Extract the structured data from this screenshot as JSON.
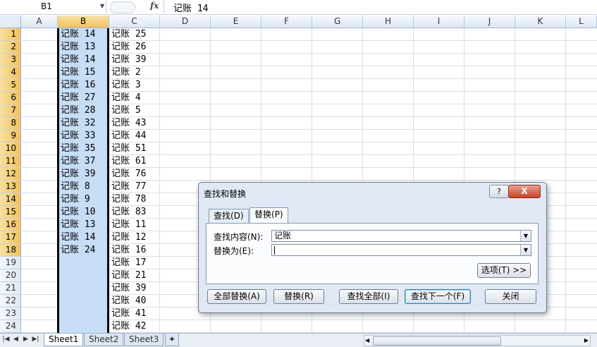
{
  "formula_bar": {
    "name_box": "B1",
    "fx_label": "fx",
    "content": "记账 14"
  },
  "columns": [
    "A",
    "B",
    "C",
    "D",
    "E",
    "F",
    "G",
    "H",
    "I",
    "J",
    "K",
    "L"
  ],
  "selected_column": "B",
  "rows": [
    "1",
    "2",
    "3",
    "4",
    "5",
    "6",
    "7",
    "8",
    "9",
    "10",
    "11",
    "12",
    "13",
    "14",
    "15",
    "16",
    "17",
    "18",
    "19",
    "20",
    "21",
    "22",
    "23",
    "24"
  ],
  "column_b": [
    "记账 14",
    "记账 13",
    "记账 14",
    "记账 15",
    "记账 16",
    "记账 27",
    "记账 28",
    "记账 32",
    "记账 33",
    "记账 35",
    "记账 37",
    "记账 39",
    "记账 8",
    "记账 9",
    "记账 10",
    "记账 13",
    "记账 14",
    "记账 24"
  ],
  "column_c": [
    "记账 25",
    "记账 26",
    "记账 39",
    "记账 2",
    "记账 3",
    "记账 4",
    "记账 5",
    "记账 43",
    "记账 44",
    "记账 51",
    "记账 61",
    "记账 76",
    "记账 77",
    "记账 78",
    "记账 83",
    "记账 11",
    "记账 12",
    "记账 16",
    "记账 17",
    "记账 21",
    "记账 39",
    "记账 40",
    "记账 41",
    "记账 42"
  ],
  "sheet_tabs": [
    "Sheet1",
    "Sheet2",
    "Sheet3"
  ],
  "active_sheet": "Sheet1",
  "dialog": {
    "title": "查找和替换",
    "help": "?",
    "close": "X",
    "tabs": [
      "查找(D)",
      "替换(P)"
    ],
    "active_tab": "替换(P)",
    "find_label": "查找内容(N):",
    "find_value": "记账",
    "replace_label": "替换为(E):",
    "replace_value": "",
    "options_button": "选项(T) >>",
    "buttons": {
      "replace_all": "全部替换(A)",
      "replace": "替换(R)",
      "find_all": "查找全部(I)",
      "find_next": "查找下一个(F)",
      "close": "关闭"
    }
  },
  "colors": {
    "selection": "#c7dcf5",
    "header_selected": "#f1c15f",
    "dialog_bg": "#dfe8f4",
    "close_red": "#c7432a"
  }
}
